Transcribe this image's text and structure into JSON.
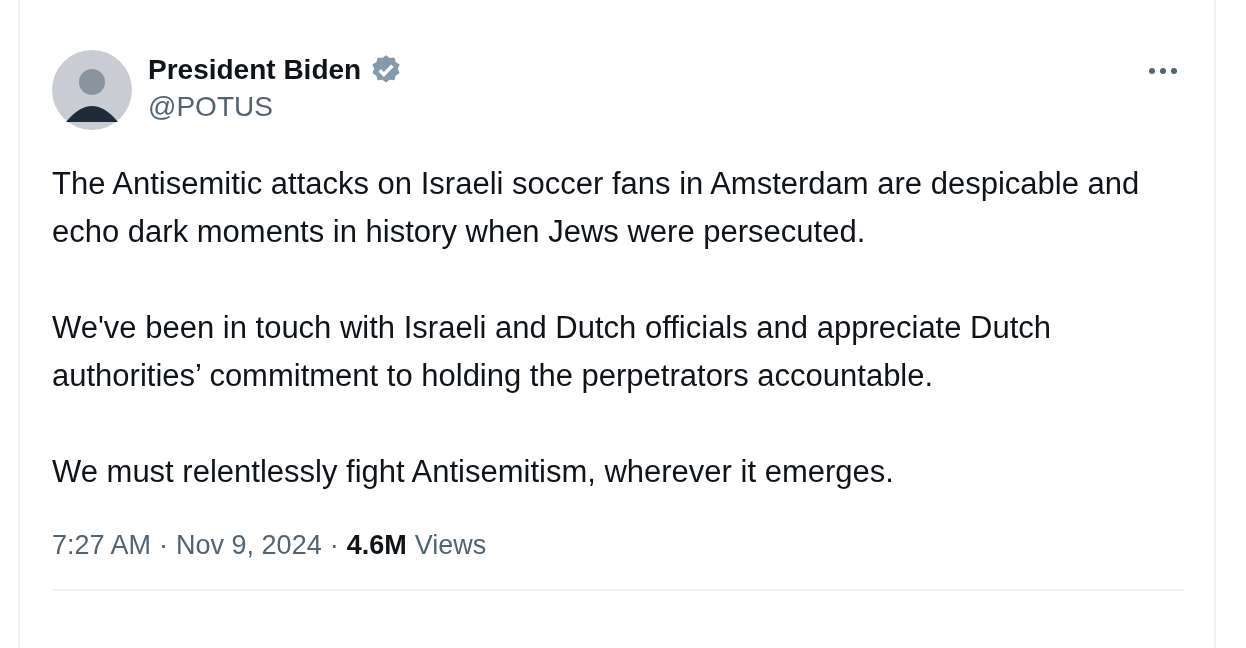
{
  "post": {
    "author": {
      "name": "President Biden",
      "verified": true,
      "handle": "@POTUS"
    },
    "paragraphs": [
      "The Antisemitic attacks on Israeli soccer fans in Amsterdam are despicable and echo dark moments in history when Jews were persecuted.",
      "We've been in touch with Israeli and Dutch officials and appreciate Dutch authorities’ commitment to holding the perpetrators accountable.",
      "We must relentlessly fight Antisemitism, wherever it emerges."
    ],
    "time": "7:27 AM",
    "date": "Nov 9, 2024",
    "separator": "·",
    "views_count": "4.6M",
    "views_label": "Views"
  }
}
